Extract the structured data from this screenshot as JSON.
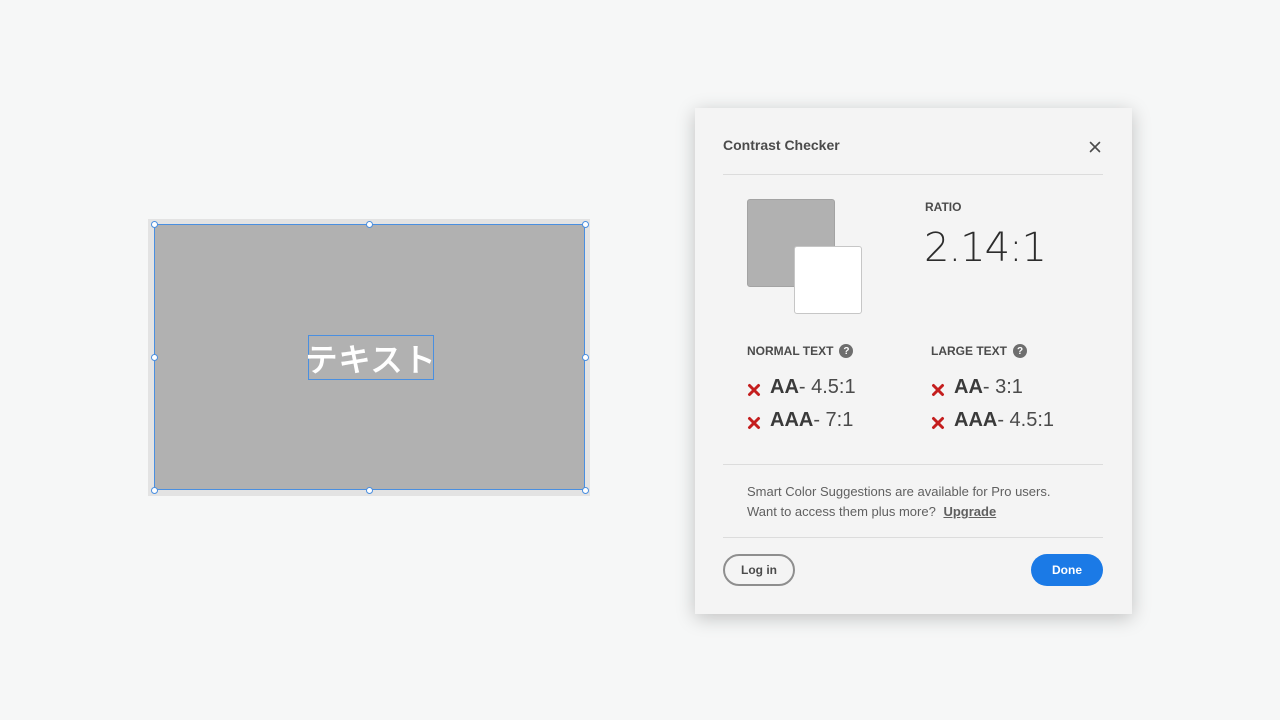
{
  "artboard": {
    "text": "テキスト",
    "fill_color": "#b1b1b1",
    "text_color": "#ffffff",
    "selection_color": "#4a8fe0"
  },
  "dialog": {
    "title": "Contrast Checker",
    "close_icon": "close-icon",
    "swatches": {
      "background": "#b1b1b1",
      "foreground": "#ffffff"
    },
    "ratio_label": "RATIO",
    "ratio_value": "2.14:1",
    "normal_text": {
      "heading": "NORMAL TEXT",
      "help_icon": "help-icon",
      "help_glyph": "?",
      "results": [
        {
          "level": "AA",
          "requirement": "- 4.5:1",
          "status": "fail"
        },
        {
          "level": "AAA",
          "requirement": "- 7:1",
          "status": "fail"
        }
      ]
    },
    "large_text": {
      "heading": "LARGE TEXT",
      "help_icon": "help-icon",
      "help_glyph": "?",
      "results": [
        {
          "level": "AA",
          "requirement": "- 3:1",
          "status": "fail"
        },
        {
          "level": "AAA",
          "requirement": "- 4.5:1",
          "status": "fail"
        }
      ]
    },
    "pro_line1": "Smart Color Suggestions are available for Pro users.",
    "pro_line2": "Want to access them plus more?",
    "upgrade_label": "Upgrade",
    "login_label": "Log in",
    "done_label": "Done",
    "colors": {
      "fail": "#c41e1e",
      "primary": "#1b7ae6"
    }
  }
}
